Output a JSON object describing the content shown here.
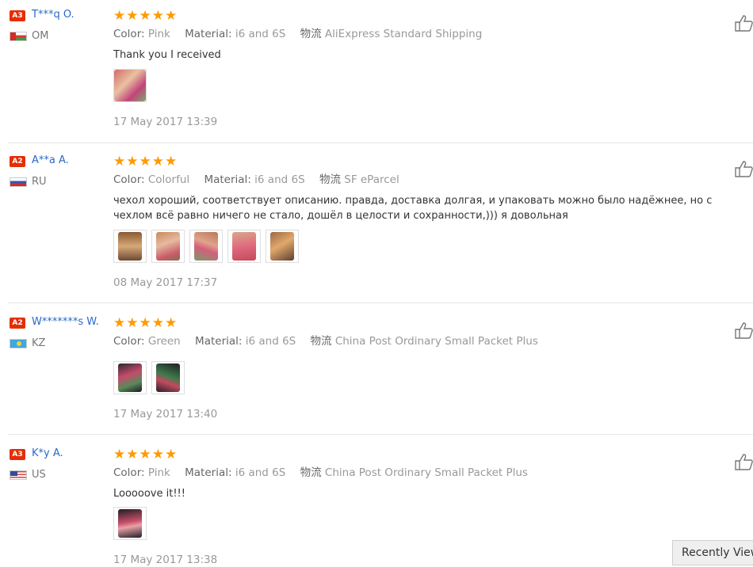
{
  "labels": {
    "color": "Color:",
    "material": "Material:",
    "shipping": "物流"
  },
  "reviews": [
    {
      "badge": "A3",
      "name": "T***q O.",
      "country": "OM",
      "rating": "★★★★★",
      "color": "Pink",
      "material": "i6 and 6S",
      "shipping": "AliExpress Standard Shipping",
      "text": "Thank you I received",
      "photo_count": 1,
      "date": "17 May 2017 13:39"
    },
    {
      "badge": "A2",
      "name": "A**a A.",
      "country": "RU",
      "rating": "★★★★★",
      "color": "Colorful",
      "material": "i6 and 6S",
      "shipping": "SF eParcel",
      "text": "чехол хороший, соответствует описанию. правда, доставка долгая, и упаковать можно было надёжнее, но с чехлом всё равно ничего не стало, дошёл в целости и сохранности,))) я довольная",
      "photo_count": 5,
      "date": "08 May 2017 17:37"
    },
    {
      "badge": "A2",
      "name": "W*******s W.",
      "country": "KZ",
      "rating": "★★★★★",
      "color": "Green",
      "material": "i6 and 6S",
      "shipping": "China Post Ordinary Small Packet Plus",
      "text": "",
      "photo_count": 2,
      "date": "17 May 2017 13:40"
    },
    {
      "badge": "A3",
      "name": "K*y A.",
      "country": "US",
      "rating": "★★★★★",
      "color": "Pink",
      "material": "i6 and 6S",
      "shipping": "China Post Ordinary Small Packet Plus",
      "text": "Looooove it!!!",
      "photo_count": 1,
      "date": "17 May 2017 13:38"
    }
  ],
  "recently_viewed": "Recently Viewed",
  "colors": {
    "accent_star": "#ff9a00",
    "badge": "#e62e04",
    "username": "#2a6ac9"
  }
}
